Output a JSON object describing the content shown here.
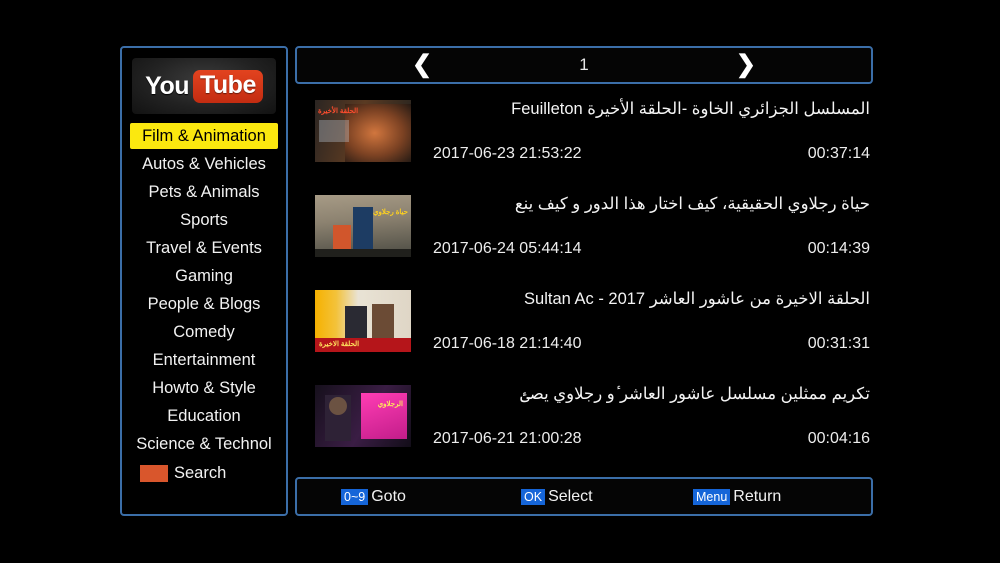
{
  "app": {
    "logo_you": "You",
    "logo_tube": "Tube"
  },
  "sidebar": {
    "items": [
      {
        "label": "Film & Animation",
        "selected": true
      },
      {
        "label": "Autos & Vehicles",
        "selected": false
      },
      {
        "label": "Pets & Animals",
        "selected": false
      },
      {
        "label": "Sports",
        "selected": false
      },
      {
        "label": "Travel & Events",
        "selected": false
      },
      {
        "label": "Gaming",
        "selected": false
      },
      {
        "label": "People & Blogs",
        "selected": false
      },
      {
        "label": "Comedy",
        "selected": false
      },
      {
        "label": "Entertainment",
        "selected": false
      },
      {
        "label": "Howto & Style",
        "selected": false
      },
      {
        "label": "Education",
        "selected": false
      },
      {
        "label": "Science & Technol",
        "selected": false
      }
    ],
    "search_label": "Search"
  },
  "pager": {
    "prev_icon": "❮",
    "next_icon": "❯",
    "page": "1"
  },
  "videos": [
    {
      "title": "المسلسل الجزائري الخاوة  -الحلقة الأخيرة Feuilleton",
      "date": "2017-06-23 21:53:22",
      "duration": "00:37:14",
      "thumb_overlay": "الحلقة الأخيرة"
    },
    {
      "title": "حياة رجلاوي الحقيقية، كيف اختار هذا الدور و كيف ينع",
      "date": "2017-06-24 05:44:14",
      "duration": "00:14:39",
      "thumb_overlay": "حياة رجلاوي"
    },
    {
      "title": "الحلقة الاخيرة من عاشور العاشر Sultan Ac  -  2017",
      "date": "2017-06-18 21:14:40",
      "duration": "00:31:31",
      "thumb_overlay": "الحلقة الاخيرة"
    },
    {
      "title": "تكريم ممثلين مسلسل عاشور العاشر ٔو رجلاوي يصٸ",
      "date": "2017-06-21 21:00:28",
      "duration": "00:04:16",
      "thumb_overlay": "الرجلاوي"
    }
  ],
  "keybar": {
    "hints": [
      {
        "cap": "0~9",
        "label": "Goto"
      },
      {
        "cap": "OK",
        "label": "Select"
      },
      {
        "cap": "Menu",
        "label": "Return"
      }
    ]
  },
  "colors": {
    "panel_border": "#3b6ea8",
    "highlight": "#fbe80f",
    "keycap": "#1565d8",
    "search_swatch": "#d9562c",
    "brand_red": "#cf3318",
    "background": "#000000"
  }
}
